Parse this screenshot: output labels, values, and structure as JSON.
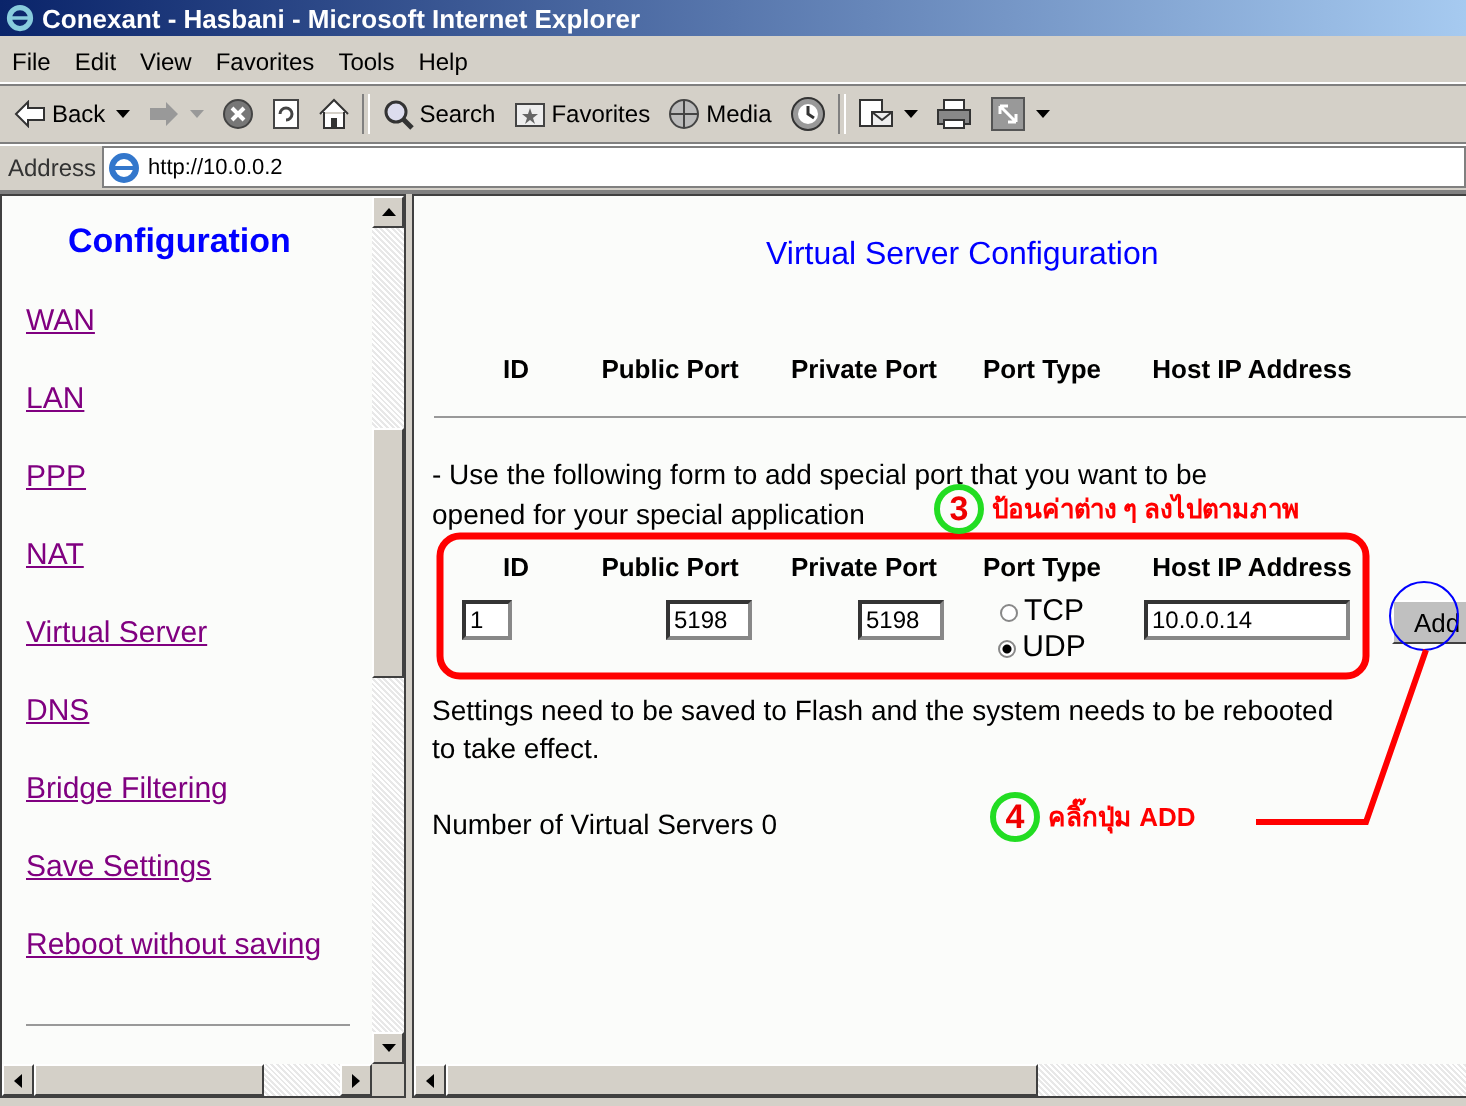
{
  "window": {
    "title": "Conexant - Hasbani - Microsoft Internet Explorer"
  },
  "menu": [
    "File",
    "Edit",
    "View",
    "Favorites",
    "Tools",
    "Help"
  ],
  "toolbar": [
    {
      "kind": "back",
      "label": "Back",
      "dropdown": true
    },
    {
      "kind": "forward",
      "dropdown": true
    },
    {
      "kind": "stop"
    },
    {
      "kind": "refresh"
    },
    {
      "kind": "home"
    },
    {
      "kind": "search",
      "label": "Search"
    },
    {
      "kind": "favorites",
      "label": "Favorites"
    },
    {
      "kind": "media",
      "label": "Media"
    },
    {
      "kind": "history"
    },
    {
      "kind": "mail",
      "dropdown": true
    },
    {
      "kind": "print"
    },
    {
      "kind": "edit",
      "dropdown": true
    }
  ],
  "address": {
    "label": "Address",
    "value": "http://10.0.0.2"
  },
  "sidebar": {
    "title": "Configuration",
    "links": [
      "WAN",
      "LAN",
      "PPP",
      "NAT",
      "Virtual Server",
      "DNS",
      "Bridge Filtering",
      "Save Settings",
      "Reboot without saving"
    ]
  },
  "main": {
    "title": "Virtual Server Configuration",
    "table_headers": [
      "ID",
      "Public Port",
      "Private Port",
      "Port Type",
      "Host IP Address"
    ],
    "instructions": [
      "- Use the following form to add special port that you want to be",
      "opened for your special application"
    ],
    "form": {
      "headers": [
        "ID",
        "Public Port",
        "Private Port",
        "Port Type",
        "Host IP Address"
      ],
      "id": "1",
      "public_port": "5198",
      "private_port": "5198",
      "port_types": [
        {
          "label": "TCP",
          "selected": false
        },
        {
          "label": "UDP",
          "selected": true
        }
      ],
      "host_ip": "10.0.0.14",
      "button": "Add"
    },
    "notes": [
      "Settings need to be saved to Flash and the system needs to be rebooted",
      "to take effect."
    ],
    "count": "Number of Virtual Servers 0"
  },
  "annotations": [
    {
      "number": "3",
      "text": "ป้อนค่าต่าง ๆ ลงไปตามภาพ"
    },
    {
      "number": "4",
      "text": "คลิ๊กปุ่ม ADD"
    }
  ]
}
